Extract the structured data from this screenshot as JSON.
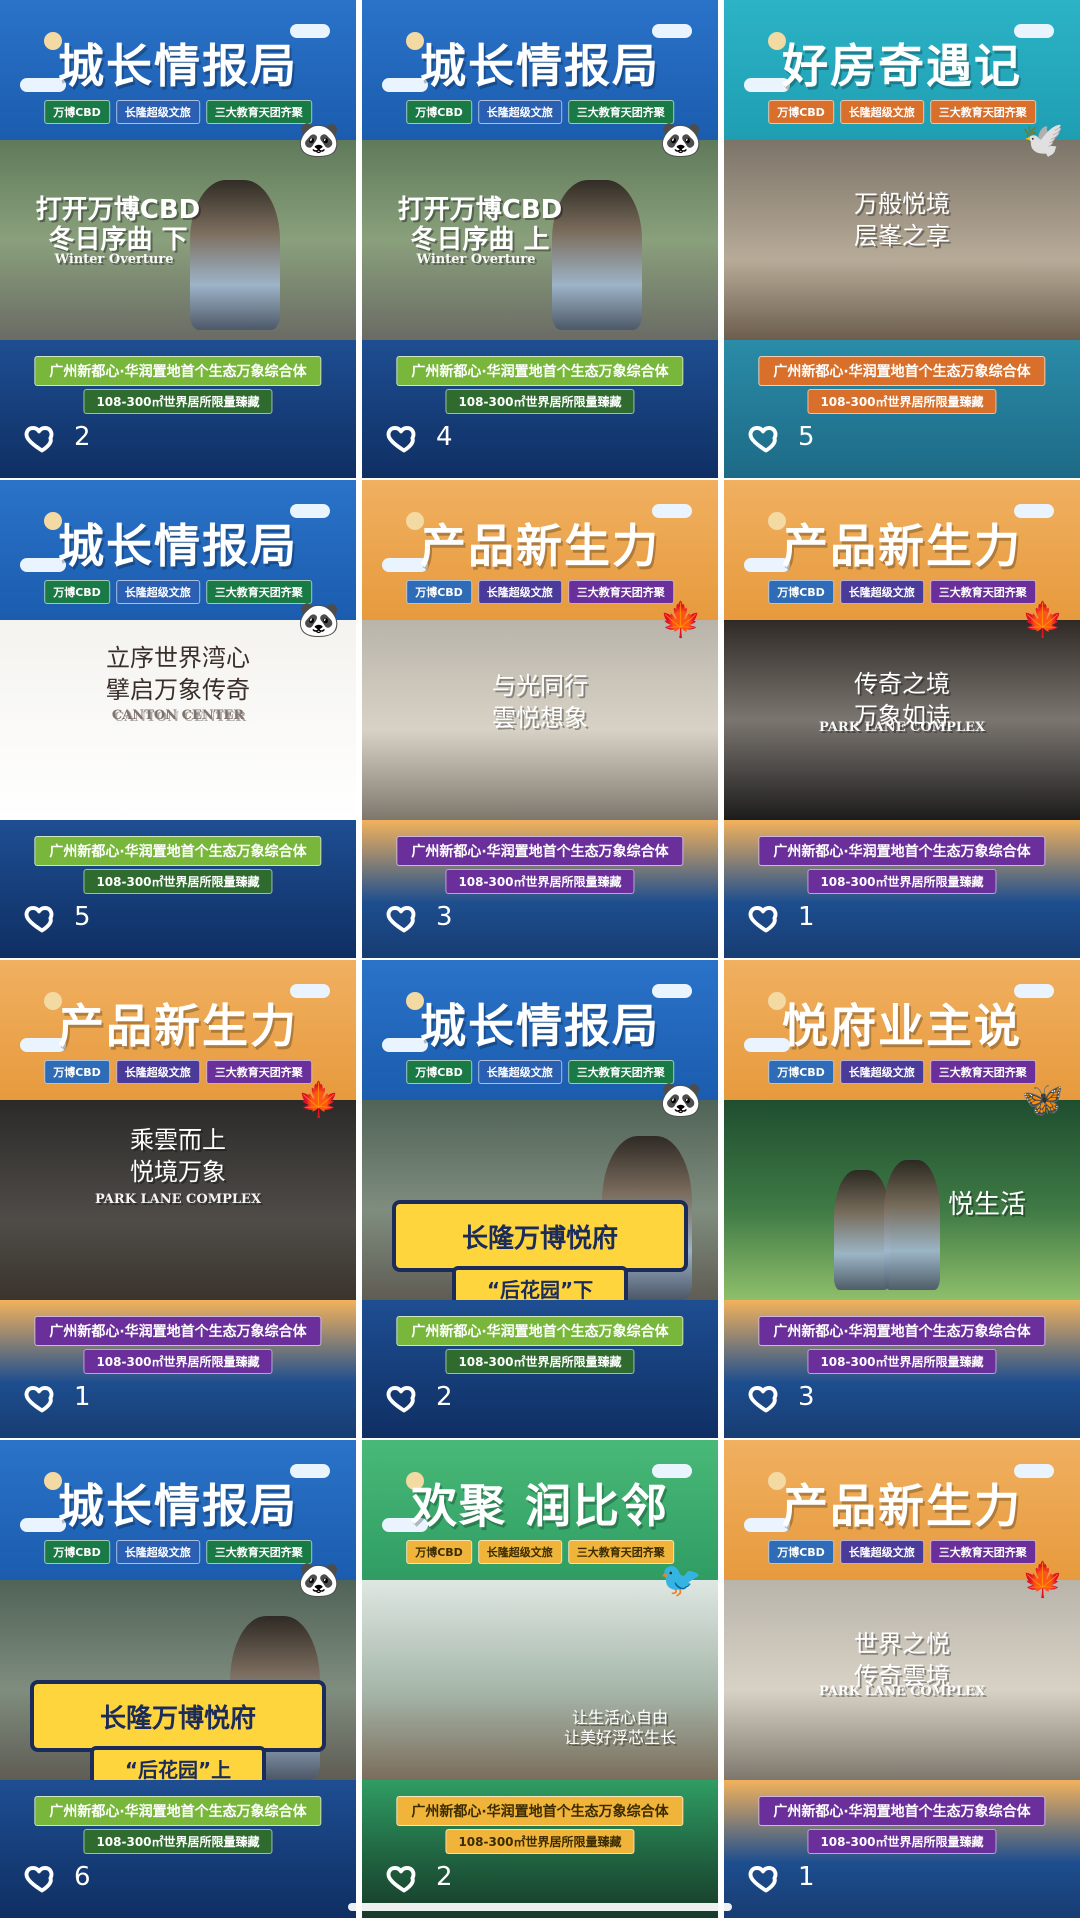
{
  "posts": [
    {
      "title": "城长情报局",
      "tags": [
        "万博CBD",
        "长隆超级文旅",
        "三大教育天团齐聚"
      ],
      "overlay": "打开万博CBD\n冬日序曲 下",
      "overlay_sub": "Winter Overture",
      "banner": "",
      "banner2": "",
      "sub1": "广州新都心·华润置地首个生态万象综合体",
      "sub2": "108-300㎡世界居所限量臻藏",
      "likes": "2"
    },
    {
      "title": "城长情报局",
      "tags": [
        "万博CBD",
        "长隆超级文旅",
        "三大教育天团齐聚"
      ],
      "overlay": "打开万博CBD\n冬日序曲 上",
      "overlay_sub": "Winter Overture",
      "banner": "",
      "banner2": "",
      "sub1": "广州新都心·华润置地首个生态万象综合体",
      "sub2": "108-300㎡世界居所限量臻藏",
      "likes": "4"
    },
    {
      "title": "好房奇遇记",
      "tags": [
        "万博CBD",
        "长隆超级文旅",
        "三大教育天团齐聚"
      ],
      "overlay": "万般悦境\n层峯之享",
      "overlay_sub": "",
      "banner": "",
      "banner2": "",
      "sub1": "广州新都心·华润置地首个生态万象综合体",
      "sub2": "108-300㎡世界居所限量臻藏",
      "likes": "5"
    },
    {
      "title": "城长情报局",
      "tags": [
        "万博CBD",
        "长隆超级文旅",
        "三大教育天团齐聚"
      ],
      "overlay": "立序世界湾心\n擘启万象传奇",
      "overlay_sub": "CANTON CENTER",
      "banner": "",
      "banner2": "",
      "sub1": "广州新都心·华润置地首个生态万象综合体",
      "sub2": "108-300㎡世界居所限量臻藏",
      "likes": "5"
    },
    {
      "title": "产品新生力",
      "tags": [
        "万博CBD",
        "长隆超级文旅",
        "三大教育天团齐聚"
      ],
      "overlay": "与光同行\n雲悦想象",
      "overlay_sub": "",
      "banner": "",
      "banner2": "",
      "sub1": "广州新都心·华润置地首个生态万象综合体",
      "sub2": "108-300㎡世界居所限量臻藏",
      "likes": "3"
    },
    {
      "title": "产品新生力",
      "tags": [
        "万博CBD",
        "长隆超级文旅",
        "三大教育天团齐聚"
      ],
      "overlay": "传奇之境\n万象如诗",
      "overlay_sub": "PARK LANE COMPLEX",
      "banner": "",
      "banner2": "",
      "sub1": "广州新都心·华润置地首个生态万象综合体",
      "sub2": "108-300㎡世界居所限量臻藏",
      "likes": "1"
    },
    {
      "title": "产品新生力",
      "tags": [
        "万博CBD",
        "长隆超级文旅",
        "三大教育天团齐聚"
      ],
      "overlay": "乘雲而上\n悦境万象",
      "overlay_sub": "PARK LANE COMPLEX",
      "banner": "",
      "banner2": "",
      "sub1": "广州新都心·华润置地首个生态万象综合体",
      "sub2": "108-300㎡世界居所限量臻藏",
      "likes": "1"
    },
    {
      "title": "城长情报局",
      "tags": [
        "万博CBD",
        "长隆超级文旅",
        "三大教育天团齐聚"
      ],
      "overlay": "",
      "overlay_sub": "",
      "banner": "长隆万博悦府",
      "banner2": "“后花园”下",
      "sub1": "广州新都心·华润置地首个生态万象综合体",
      "sub2": "108-300㎡世界居所限量臻藏",
      "likes": "2"
    },
    {
      "title": "悦府业主说",
      "tags": [
        "万博CBD",
        "长隆超级文旅",
        "三大教育天团齐聚"
      ],
      "overlay": "悦生活",
      "overlay_sub": "",
      "banner": "",
      "banner2": "",
      "sub1": "广州新都心·华润置地首个生态万象综合体",
      "sub2": "108-300㎡世界居所限量臻藏",
      "likes": "3"
    },
    {
      "title": "城长情报局",
      "tags": [
        "万博CBD",
        "长隆超级文旅",
        "三大教育天团齐聚"
      ],
      "overlay": "",
      "overlay_sub": "",
      "banner": "长隆万博悦府",
      "banner2": "“后花园”上",
      "sub1": "广州新都心·华润置地首个生态万象综合体",
      "sub2": "108-300㎡世界居所限量臻藏",
      "likes": "6"
    },
    {
      "title": "欢聚 润比邻",
      "tags": [
        "万博CBD",
        "长隆超级文旅",
        "三大教育天团齐聚"
      ],
      "overlay": "让生活心自由\n让美好浮芯生长",
      "overlay_sub": "",
      "banner": "",
      "banner2": "",
      "sub1": "广州新都心·华润置地首个生态万象综合体",
      "sub2": "108-300㎡世界居所限量臻藏",
      "likes": "2"
    },
    {
      "title": "产品新生力",
      "tags": [
        "万博CBD",
        "长隆超级文旅",
        "三大教育天团齐聚"
      ],
      "overlay": "世界之悦\n传奇雲境",
      "overlay_sub": "PARK LANE COMPLEX",
      "banner": "",
      "banner2": "",
      "sub1": "广州新都心·华润置地首个生态万象综合体",
      "sub2": "108-300㎡世界居所限量臻藏",
      "likes": "1"
    }
  ],
  "icons": {
    "heart": "heart-icon",
    "panda": "panda-icon",
    "maple": "maple-leaf-icon",
    "bird": "bird-icon",
    "butterfly": "butterfly-icon"
  },
  "colors": {
    "blue_header": "#1b5cae",
    "orange_header": "#e79a3d",
    "teal_header": "#1f9eb2",
    "green_header": "#2f9d63"
  }
}
